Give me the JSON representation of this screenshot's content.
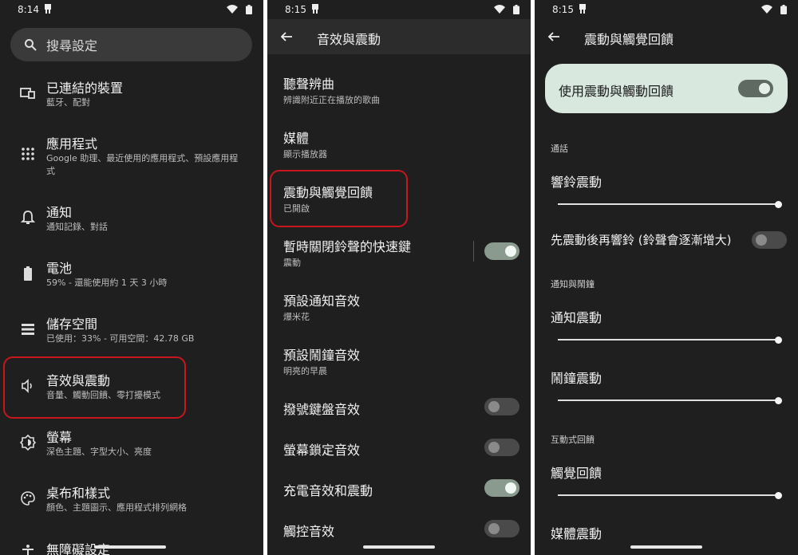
{
  "colors": {
    "background": "#1f1f1f",
    "appbar": "#2c2c2c",
    "highlight": "#c8161e",
    "toggle_on": "#8a9a8e",
    "card": "#d8e8df"
  },
  "screen1": {
    "status": {
      "time": "8:14"
    },
    "search": {
      "placeholder": "搜尋設定"
    },
    "items": [
      {
        "icon": "devices-icon",
        "title": "已連結的裝置",
        "subtitle": "藍牙、配對"
      },
      {
        "icon": "apps-icon",
        "title": "應用程式",
        "subtitle": "Google 助理、最近使用的應用程式、預設應用程式"
      },
      {
        "icon": "bell-icon",
        "title": "通知",
        "subtitle": "通知記錄、對話"
      },
      {
        "icon": "battery-icon",
        "title": "電池",
        "subtitle": "59% - 還能使用約 1 天 3 小時"
      },
      {
        "icon": "storage-icon",
        "title": "儲存空間",
        "subtitle": "已使用：33% - 可用空間：42.78 GB"
      },
      {
        "icon": "volume-icon",
        "title": "音效與震動",
        "subtitle": "音量、觸動回饋、零打擾模式"
      },
      {
        "icon": "brightness-icon",
        "title": "螢幕",
        "subtitle": "深色主題、字型大小、亮度"
      },
      {
        "icon": "palette-icon",
        "title": "桌布和樣式",
        "subtitle": "顏色、主題圖示、應用程式排列網格"
      },
      {
        "icon": "accessibility-icon",
        "title": "無障礙設定",
        "subtitle": ""
      }
    ]
  },
  "screen2": {
    "status": {
      "time": "8:15"
    },
    "title": "音效與震動",
    "rows": [
      {
        "title": "聽聲辨曲",
        "subtitle": "辨識附近正在播放的歌曲"
      },
      {
        "title": "媒體",
        "subtitle": "顯示播放器"
      },
      {
        "title": "震動與觸覺回饋",
        "subtitle": "已開啟"
      },
      {
        "title": "暫時關閉鈴聲的快速鍵",
        "subtitle": "震動",
        "toggle": true
      },
      {
        "title": "預設通知音效",
        "subtitle": "爆米花"
      },
      {
        "title": "預設鬧鐘音效",
        "subtitle": "明亮的早晨"
      },
      {
        "title": "撥號鍵盤音效",
        "subtitle": "",
        "toggle": false
      },
      {
        "title": "螢幕鎖定音效",
        "subtitle": "",
        "toggle": false
      },
      {
        "title": "充電音效和震動",
        "subtitle": "",
        "toggle": true
      },
      {
        "title": "觸控音效",
        "subtitle": "",
        "toggle": false
      }
    ]
  },
  "screen3": {
    "status": {
      "time": "8:15"
    },
    "title": "震動與觸覺回饋",
    "main_toggle": {
      "label": "使用震動與觸動回饋",
      "on": true
    },
    "section_call": "通話",
    "ring_vibration": {
      "label": "響鈴震動",
      "level": 1.0
    },
    "vibrate_first": {
      "label": "先震動後再響鈴 (鈴聲會逐漸增大)",
      "on": false
    },
    "section_notif": "通知與鬧鐘",
    "notif_vibration": {
      "label": "通知震動",
      "level": 1.0
    },
    "alarm_vibration": {
      "label": "鬧鐘震動",
      "level": 1.0
    },
    "section_interactive": "互動式回饋",
    "touch_feedback": {
      "label": "觸覺回饋",
      "level": 1.0
    },
    "media_vibration": {
      "label": "媒體震動",
      "level": 1.0
    }
  }
}
